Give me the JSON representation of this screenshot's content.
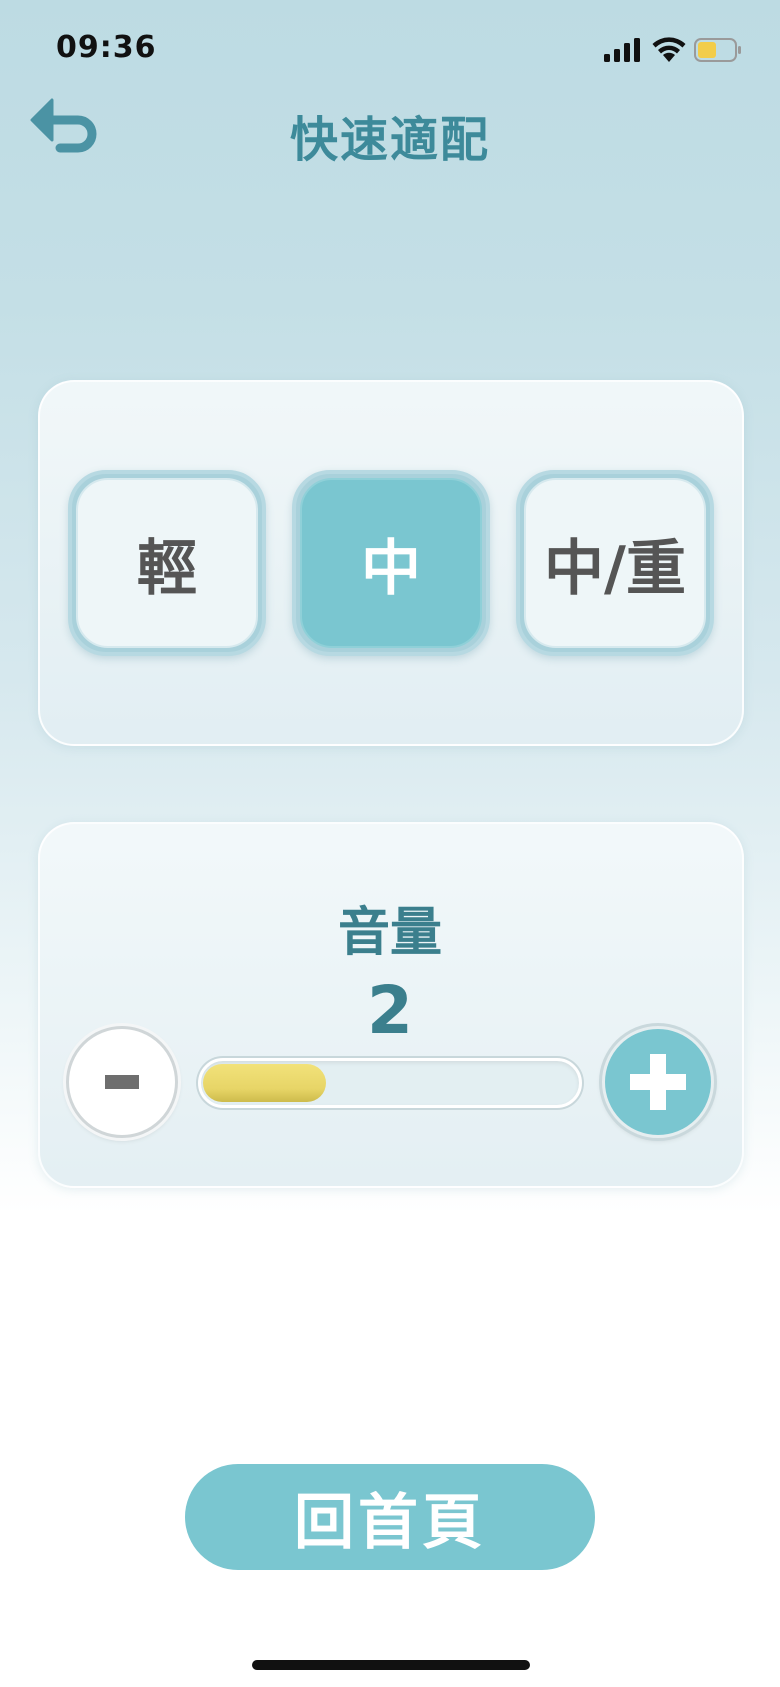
{
  "status_bar": {
    "time": "09:36"
  },
  "header": {
    "title": "快速適配"
  },
  "levels": [
    {
      "label": "輕",
      "selected": false
    },
    {
      "label": "中",
      "selected": true
    },
    {
      "label": "中/重",
      "selected": false
    }
  ],
  "volume": {
    "label": "音量",
    "value": "2",
    "level_fraction": 0.33
  },
  "home_button": {
    "label": "回首頁"
  },
  "colors": {
    "accent": "#7ac6d0",
    "title": "#3d8a9a",
    "slider_fill": "#e7d567",
    "battery": "#f2cd4a"
  }
}
